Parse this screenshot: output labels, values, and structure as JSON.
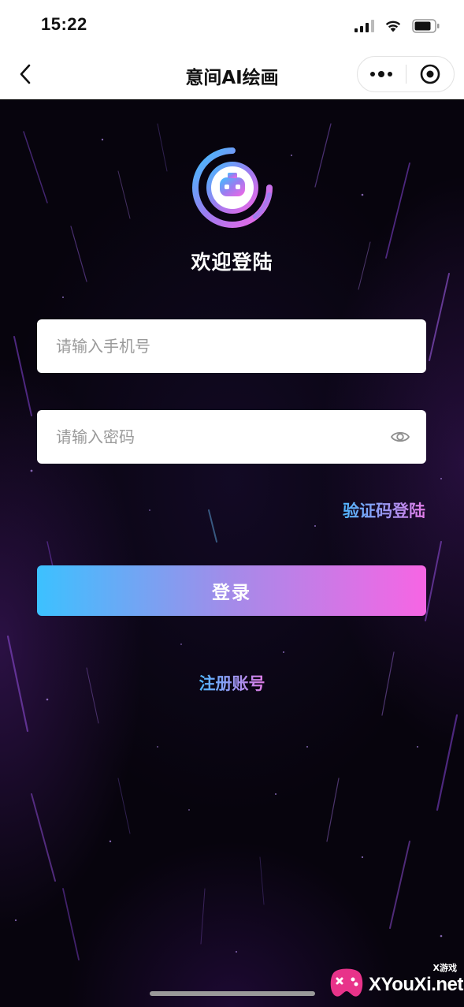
{
  "status_bar": {
    "time": "15:22"
  },
  "nav": {
    "title": "意间AI绘画",
    "back_icon": "chevron-left-icon",
    "more_icon": "more-dots-icon",
    "close_icon": "target-circle-icon"
  },
  "login": {
    "welcome": "欢迎登陆",
    "phone_placeholder": "请输入手机号",
    "password_placeholder": "请输入密码",
    "code_login_label": "验证码登陆",
    "login_button_label": "登录",
    "register_label": "注册账号"
  },
  "colors": {
    "gradient_start": "#3cc1ff",
    "gradient_mid": "#a48be9",
    "gradient_end": "#f765e4",
    "background": "#07040d"
  },
  "watermark": {
    "site": "XYouXi.net",
    "sub": "X游戏"
  }
}
